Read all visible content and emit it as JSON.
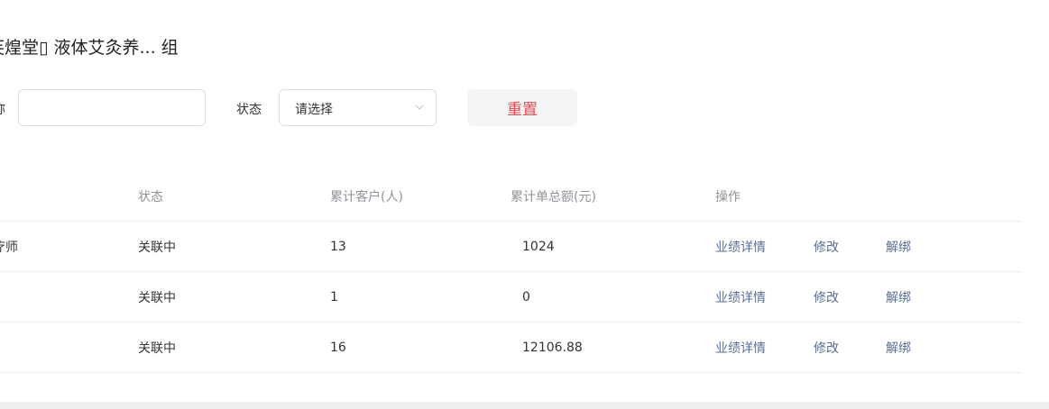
{
  "page": {
    "title": "芙煌堂▯ 液体艾灸养...  组"
  },
  "filters": {
    "name_label": "称",
    "name_value": "",
    "status_label": "状态",
    "status_placeholder": "请选择",
    "reset_label": "重置"
  },
  "table": {
    "headers": {
      "status": "状态",
      "customers": "累计客户(人)",
      "total": "累计单总额(元)",
      "ops": "操作"
    },
    "rows": [
      {
        "name": "疗师",
        "status": "关联中",
        "customers": "13",
        "total": "1024"
      },
      {
        "name": "",
        "status": "关联中",
        "customers": "1",
        "total": "0"
      },
      {
        "name": "",
        "status": "关联中",
        "customers": "16",
        "total": "12106.88"
      }
    ],
    "actions": {
      "detail": "业绩详情",
      "edit": "修改",
      "unbind": "解绑"
    }
  },
  "colors": {
    "accent_red": "#e5484d",
    "link_blue": "#5a6e94"
  }
}
